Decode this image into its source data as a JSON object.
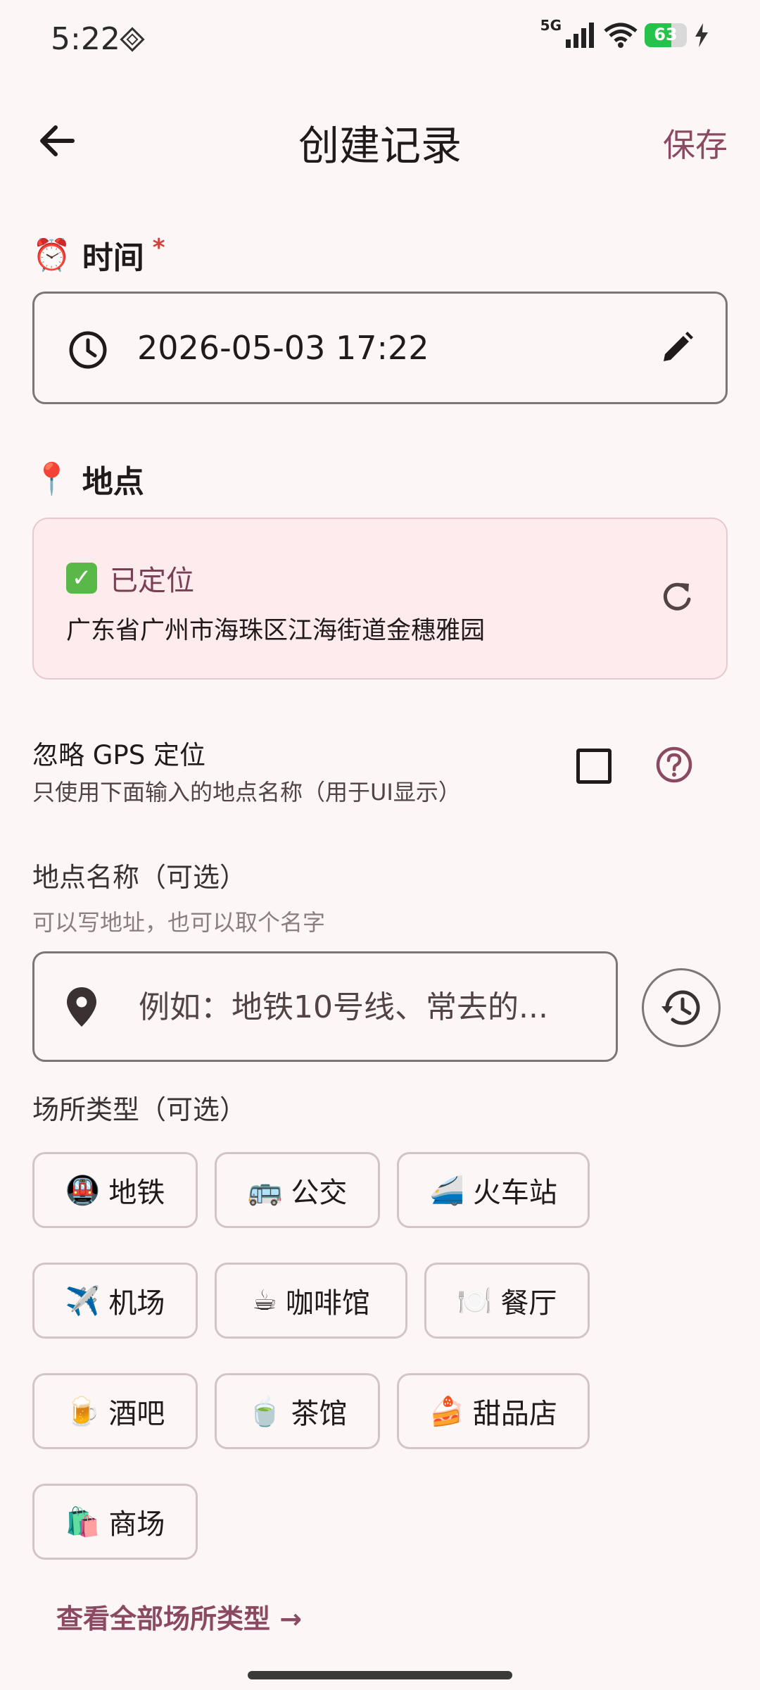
{
  "status_bar": {
    "time": "5:22",
    "network": "5G",
    "battery": "63",
    "battery_level": 0.63
  },
  "app_bar": {
    "title": "创建记录",
    "save_label": "保存"
  },
  "time_section": {
    "emoji": "⏰",
    "heading": "时间",
    "required_mark": "*",
    "value": "2026-05-03 17:22"
  },
  "location_section": {
    "emoji": "📍",
    "heading": "地点",
    "status_emoji": "✓",
    "status": "已定位",
    "address": "广东省广州市海珠区江海街道金穗雅园"
  },
  "ignore_gps": {
    "title": "忽略 GPS 定位",
    "subtitle": "只使用下面输入的地点名称（用于UI显示）",
    "checked": false
  },
  "place_name": {
    "label": "地点名称（可选）",
    "hint": "可以写地址，也可以取个名字",
    "placeholder": "例如：地铁10号线、常去的...",
    "value": ""
  },
  "venue_type": {
    "label": "场所类型（可选）",
    "chips": [
      {
        "emoji": "🚇",
        "label": "地铁"
      },
      {
        "emoji": "🚌",
        "label": "公交"
      },
      {
        "emoji": "🚄",
        "label": "火车站"
      },
      {
        "emoji": "✈️",
        "label": "机场"
      },
      {
        "emoji": "☕",
        "label": "咖啡馆"
      },
      {
        "emoji": "🍽️",
        "label": "餐厅"
      },
      {
        "emoji": "🍺",
        "label": "酒吧"
      },
      {
        "emoji": "🍵",
        "label": "茶馆"
      },
      {
        "emoji": "🍰",
        "label": "甜品店"
      },
      {
        "emoji": "🛍️",
        "label": "商场"
      }
    ],
    "view_all": "查看全部场所类型 →"
  },
  "colors": {
    "background": "#fcf7f6",
    "accent": "#8b4a62",
    "location_card": "#fdebee",
    "required": "#d0423d",
    "battery": "#27c24c"
  }
}
